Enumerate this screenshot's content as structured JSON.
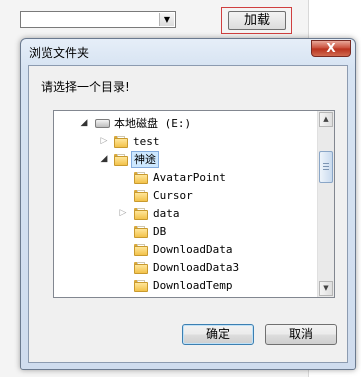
{
  "background": {
    "load_button_label": "加载"
  },
  "dialog": {
    "title": "浏览文件夹",
    "close_label": "X",
    "prompt": "请选择一个目录!",
    "ok_label": "确定",
    "cancel_label": "取消"
  },
  "tree": {
    "drive_label": "本地磁盘 (E:)",
    "items": [
      {
        "label": "test"
      },
      {
        "label": "神途"
      },
      {
        "label": "AvatarPoint"
      },
      {
        "label": "Cursor"
      },
      {
        "label": "data"
      },
      {
        "label": "DB"
      },
      {
        "label": "DownloadData"
      },
      {
        "label": "DownloadData3"
      },
      {
        "label": "DownloadTemp"
      }
    ]
  },
  "icons": {
    "combo_arrow": "▼",
    "expanded": "◢",
    "collapsed": "▷",
    "scroll_up": "▲",
    "scroll_down": "▼"
  }
}
